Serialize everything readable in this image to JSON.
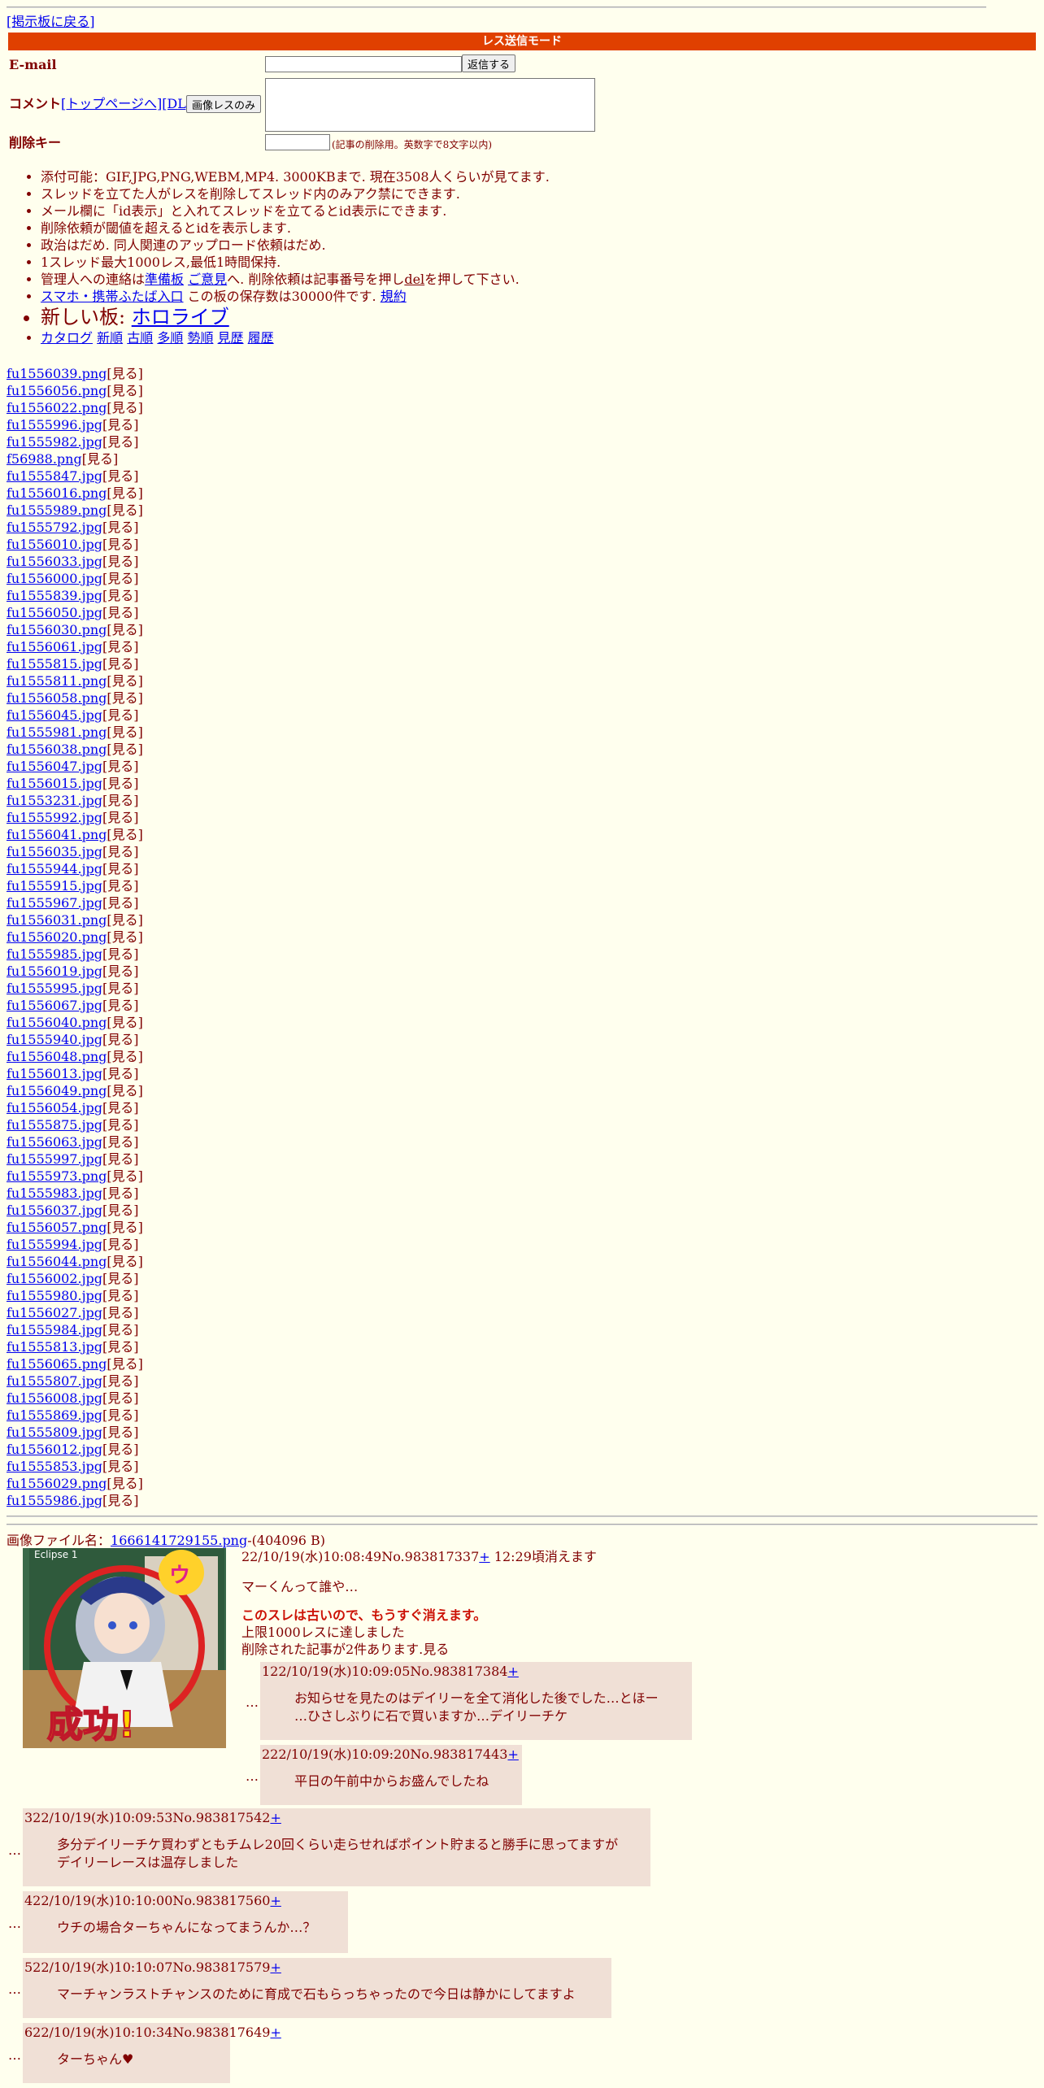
{
  "nav": {
    "back_label": "[掲示板に戻る]"
  },
  "mode_bar": "レス送信モード",
  "form": {
    "email_label": "E-mail",
    "send_label": "返信する",
    "comment_label": "コメント",
    "top_link_label": "[トップページへ]",
    "dl_link_label": "[DL]",
    "image_only_label": "画像レスのみ",
    "delkey_label": "削除キー",
    "delkey_note": "(記事の削除用。英数字で8文字以内)"
  },
  "rules": {
    "r1": "添付可能：GIF,JPG,PNG,WEBM,MP4. 3000KBまで. 現在3508人くらいが見てます.",
    "r2": "スレッドを立てた人がレスを削除してスレッド内のみアク禁にできます.",
    "r3": "メール欄に「id表示」と入れてスレッドを立てるとid表示にできます.",
    "r4": "削除依頼が閾値を超えるとidを表示します.",
    "r5": "政治はだめ. 同人関連のアップロード依頼はだめ.",
    "r6": "1スレッド最大1000レス,最低1時間保持.",
    "r7_pre": "管理人への連絡は",
    "r7_link1": "準備板",
    "r7_link2": "ご意見",
    "r7_mid": "へ. 削除依頼は記事番号を押し",
    "r7_del": "del",
    "r7_post": "を押して下さい.",
    "r8_link": "スマホ・携帯ふたば入口",
    "r8_text": " この板の保存数は30000件です. ",
    "r8_link2": "規約",
    "new_board_label": "新しい板: ",
    "new_board_link": "ホロライブ",
    "sort": {
      "catalog": "カタログ",
      "new": "新順",
      "old": "古順",
      "many": "多順",
      "momentum": "勢順",
      "seen": "見歴",
      "history": "履歴"
    }
  },
  "view_label": "[見る]",
  "files": [
    "fu1556039.png",
    "fu1556056.png",
    "fu1556022.png",
    "fu1555996.jpg",
    "fu1555982.jpg",
    "f56988.png",
    "fu1555847.jpg",
    "fu1556016.png",
    "fu1555989.png",
    "fu1555792.jpg",
    "fu1556010.jpg",
    "fu1556033.jpg",
    "fu1556000.jpg",
    "fu1555839.jpg",
    "fu1556050.jpg",
    "fu1556030.png",
    "fu1556061.jpg",
    "fu1555815.jpg",
    "fu1555811.png",
    "fu1556058.png",
    "fu1556045.jpg",
    "fu1555981.png",
    "fu1556038.png",
    "fu1556047.jpg",
    "fu1556015.jpg",
    "fu1553231.jpg",
    "fu1555992.jpg",
    "fu1556041.png",
    "fu1556035.jpg",
    "fu1555944.jpg",
    "fu1555915.jpg",
    "fu1555967.jpg",
    "fu1556031.png",
    "fu1556020.png",
    "fu1555985.jpg",
    "fu1556019.jpg",
    "fu1555995.jpg",
    "fu1556067.jpg",
    "fu1556040.png",
    "fu1555940.jpg",
    "fu1556048.png",
    "fu1556013.jpg",
    "fu1556049.png",
    "fu1556054.jpg",
    "fu1555875.jpg",
    "fu1556063.jpg",
    "fu1555997.jpg",
    "fu1555973.png",
    "fu1555983.jpg",
    "fu1556037.jpg",
    "fu1556057.png",
    "fu1555994.jpg",
    "fu1556044.png",
    "fu1556002.jpg",
    "fu1555980.jpg",
    "fu1556027.jpg",
    "fu1555984.jpg",
    "fu1555813.jpg",
    "fu1556065.png",
    "fu1555807.jpg",
    "fu1556008.jpg",
    "fu1555869.jpg",
    "fu1555809.jpg",
    "fu1556012.jpg",
    "fu1555853.jpg",
    "fu1556029.png",
    "fu1555986.jpg"
  ],
  "thread": {
    "image_label": "画像ファイル名：",
    "image_name": "1666141729155.png",
    "image_size": "-(404096 B)",
    "thumb_text": "成功!",
    "thumb_corner_text": "Eclipse 1",
    "op_head": "22/10/19(水)10:08:49No.983817337",
    "plus": "+",
    "op_expire": " 12:29頃消えます",
    "op_body": "マーくんって誰や…",
    "old_warning": "このスレは古いので、もうすぐ消えます。",
    "limit_note": "上限1000レスに達しました",
    "deleted_note": "削除された記事が2件あります.見る",
    "dots": "…"
  },
  "replies": [
    {
      "head": "122/10/19(水)10:09:05No.983817384",
      "body": "お知らせを見たのはデイリーを全て消化した後でした…とほー\n…ひさしぶりに石で買いますか…デイリーチケ"
    },
    {
      "head": "222/10/19(水)10:09:20No.983817443",
      "body": "平日の午前中からお盛んでしたね"
    },
    {
      "head": "322/10/19(水)10:09:53No.983817542",
      "body": "多分デイリーチケ買わずともチムレ20回くらい走らせればポイント貯まると勝手に思ってますが\nデイリーレースは温存しました"
    },
    {
      "head": "422/10/19(水)10:10:00No.983817560",
      "body": "ウチの場合ターちゃんになってまうんか…？"
    },
    {
      "head": "522/10/19(水)10:10:07No.983817579",
      "body": "マーチャンラストチャンスのために育成で石もらっちゃったので今日は静かにしてますよ"
    },
    {
      "head": "622/10/19(水)10:10:34No.983817649",
      "body": "ターちゃん♥"
    }
  ]
}
